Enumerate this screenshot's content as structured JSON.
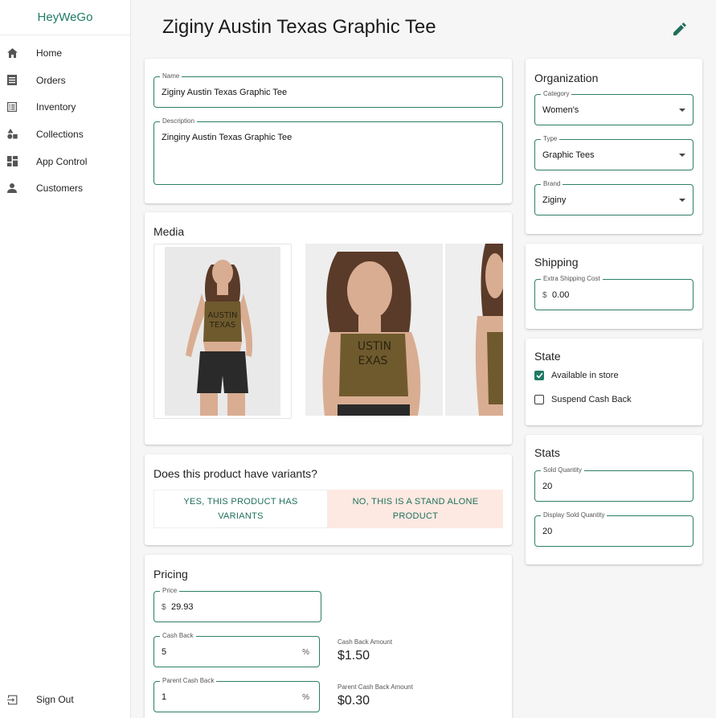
{
  "app": {
    "brand": "HeyWeGo"
  },
  "nav": {
    "items": [
      {
        "label": "Home",
        "icon": "home-icon"
      },
      {
        "label": "Orders",
        "icon": "receipt-icon"
      },
      {
        "label": "Inventory",
        "icon": "list-icon"
      },
      {
        "label": "Collections",
        "icon": "category-icon"
      },
      {
        "label": "App Control",
        "icon": "dashboard-icon"
      },
      {
        "label": "Customers",
        "icon": "person-icon"
      }
    ],
    "signout": "Sign Out"
  },
  "header": {
    "title": "Ziginy Austin Texas Graphic Tee",
    "edit_icon": "pencil-icon"
  },
  "details": {
    "name_label": "Name",
    "name_value": "Ziginy Austin Texas Graphic Tee",
    "description_label": "Description",
    "description_value": "Zinginy Austin Texas Graphic Tee"
  },
  "media": {
    "title": "Media",
    "images": [
      "product-photo-full-body",
      "product-photo-closeup",
      "product-photo-side"
    ]
  },
  "variants": {
    "question": "Does this product have variants?",
    "yes_label": "YES, THIS PRODUCT HAS VARIANTS",
    "no_label": "NO, THIS IS A STAND ALONE PRODUCT",
    "selected": "no"
  },
  "pricing": {
    "title": "Pricing",
    "price_label": "Price",
    "price_prefix": "$",
    "price_value": "29.93",
    "cashback_label": "Cash Back",
    "cashback_value": "5",
    "cashback_suffix": "%",
    "cashback_amount_label": "Cash Back Amount",
    "cashback_amount_value": "$1.50",
    "parent_cashback_label": "Parent Cash Back",
    "parent_cashback_value": "1",
    "parent_cashback_suffix": "%",
    "parent_cashback_amount_label": "Parent Cash Back Amount",
    "parent_cashback_amount_value": "$0.30"
  },
  "organization": {
    "title": "Organization",
    "category_label": "Category",
    "category_value": "Women's",
    "type_label": "Type",
    "type_value": "Graphic Tees",
    "brand_label": "Brand",
    "brand_value": "Ziginy"
  },
  "shipping": {
    "title": "Shipping",
    "extra_label": "Extra Shipping Cost",
    "extra_prefix": "$",
    "extra_value": "0.00"
  },
  "state": {
    "title": "State",
    "available_label": "Available in store",
    "available_checked": true,
    "suspend_label": "Suspend Cash Back",
    "suspend_checked": false
  },
  "stats": {
    "title": "Stats",
    "sold_label": "Sold Quantity",
    "sold_value": "20",
    "display_sold_label": "Display Sold Quantity",
    "display_sold_value": "20"
  },
  "colors": {
    "accent": "#1f7a64",
    "selected_bg": "#fde9e2",
    "page_bg": "#f6f6f6"
  }
}
